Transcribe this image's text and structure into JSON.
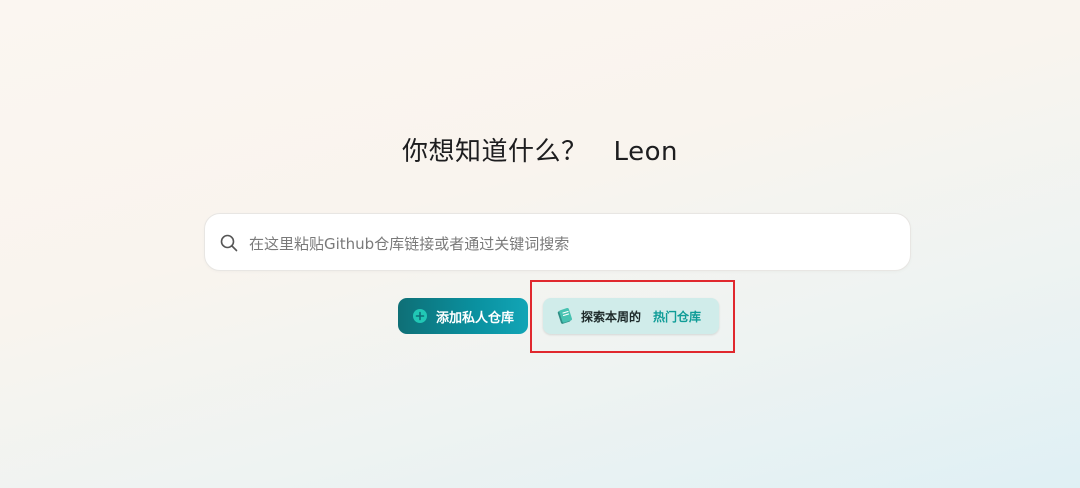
{
  "hero": {
    "question": "你想知道什么？",
    "user_name": "Leon"
  },
  "search": {
    "placeholder": "在这里粘贴Github仓库链接或者通过关键词搜索",
    "icon": "search-icon"
  },
  "actions": {
    "add_private_repo_label": "添加私人仓库",
    "explore_label": "探索本周的",
    "explore_accent_label": "热门仓库"
  },
  "colors": {
    "primary": "#0a91a0",
    "accent_text": "#0f9c97",
    "highlight": "#e0282e"
  }
}
